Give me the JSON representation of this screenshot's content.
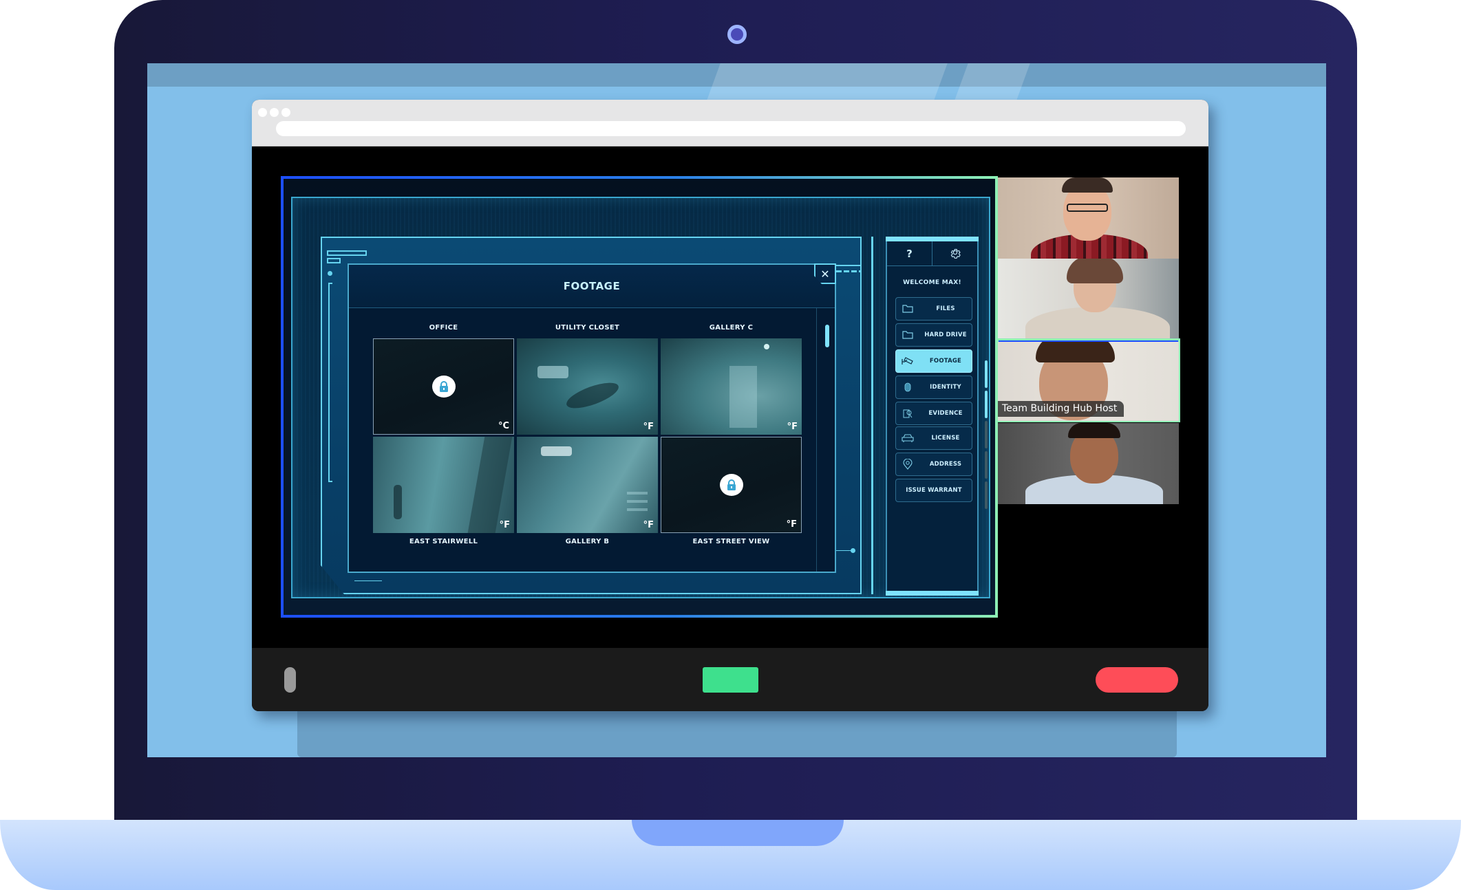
{
  "browser": {
    "window_controls": [
      "dot",
      "dot",
      "dot"
    ],
    "address_bar_value": ""
  },
  "game": {
    "modal": {
      "title": "FOOTAGE",
      "close_label": "✕",
      "cameras": [
        {
          "name": "OFFICE",
          "locked": true,
          "unit": "°C",
          "feed": "dark"
        },
        {
          "name": "UTILITY CLOSET",
          "locked": false,
          "unit": "°F",
          "feed": "feed-a"
        },
        {
          "name": "GALLERY C",
          "locked": false,
          "unit": "°F",
          "feed": "feed-b"
        },
        {
          "name": "EAST STAIRWELL",
          "locked": false,
          "unit": "°F",
          "feed": "feed-c"
        },
        {
          "name": "GALLERY B",
          "locked": false,
          "unit": "°F",
          "feed": "feed-d"
        },
        {
          "name": "EAST STREET VIEW",
          "locked": true,
          "unit": "°F",
          "feed": "dark"
        }
      ]
    },
    "sidebar": {
      "help_icon": "?",
      "settings_icon": "gear-icon",
      "welcome": "WELCOME MAX!",
      "items": [
        {
          "label": "FILES",
          "icon": "folder-icon",
          "active": false
        },
        {
          "label": "HARD DRIVE",
          "icon": "folder-icon",
          "active": false
        },
        {
          "label": "FOOTAGE",
          "icon": "security-camera-icon",
          "active": true
        },
        {
          "label": "IDENTITY",
          "icon": "fingerprint-icon",
          "active": false
        },
        {
          "label": "EVIDENCE",
          "icon": "evidence-search-icon",
          "active": false
        },
        {
          "label": "LICENSE",
          "icon": "car-icon",
          "active": false
        },
        {
          "label": "ADDRESS",
          "icon": "map-pin-icon",
          "active": false
        },
        {
          "label": "ISSUE WARRANT",
          "icon": "",
          "active": false
        }
      ]
    },
    "progress": {
      "completed_steps": 2,
      "total_steps": 5
    },
    "colors": {
      "accent": "#7fe3ff",
      "frame_blue": "#1d4fff",
      "frame_green": "#8ef0b5"
    }
  },
  "participants": [
    {
      "name": "",
      "is_speaking": false
    },
    {
      "name": "",
      "is_speaking": false
    },
    {
      "name": "Team Building Hub Host",
      "is_speaking": true
    },
    {
      "name": "",
      "is_speaking": false
    }
  ],
  "call_controls": {
    "mute_toggle": "microphone-toggle",
    "share_button_color": "#3ee08d",
    "leave_button_color": "#fe4d58"
  }
}
